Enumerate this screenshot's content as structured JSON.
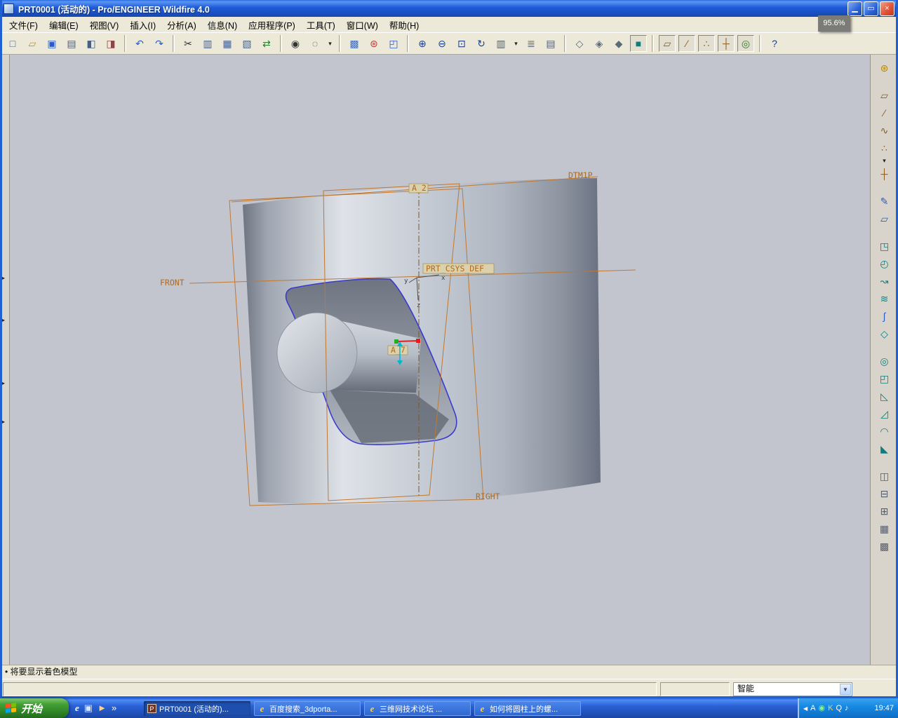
{
  "window": {
    "title": "PRT0001 (活动的) - Pro/ENGINEER Wildfire 4.0",
    "buttons": {
      "minimize": "▁",
      "restore": "▭",
      "close": "×"
    },
    "zoom_tooltip": "95.6%"
  },
  "menubar": {
    "items": [
      {
        "name": "menu-file",
        "label": "文件(F)"
      },
      {
        "name": "menu-edit",
        "label": "编辑(E)"
      },
      {
        "name": "menu-view",
        "label": "视图(V)"
      },
      {
        "name": "menu-insert",
        "label": "插入(I)"
      },
      {
        "name": "menu-analysis",
        "label": "分析(A)"
      },
      {
        "name": "menu-info",
        "label": "信息(N)"
      },
      {
        "name": "menu-applications",
        "label": "应用程序(P)"
      },
      {
        "name": "menu-tools",
        "label": "工具(T)"
      },
      {
        "name": "menu-window",
        "label": "窗口(W)"
      },
      {
        "name": "menu-help",
        "label": "帮助(H)"
      }
    ]
  },
  "toolbar": {
    "items": [
      {
        "name": "new-file-button",
        "glyph": "□",
        "color": "#46608c"
      },
      {
        "name": "open-file-button",
        "glyph": "▱",
        "color": "#c8921e"
      },
      {
        "name": "save-button",
        "glyph": "▣",
        "color": "#2b5bc8"
      },
      {
        "name": "print-button",
        "glyph": "▤",
        "color": "#555e6a"
      },
      {
        "name": "erase-display-button",
        "glyph": "◧",
        "color": "#46608c"
      },
      {
        "name": "delete-old-versions-button",
        "glyph": "◨",
        "color": "#8c4646"
      },
      {
        "sep": true
      },
      {
        "name": "undo-button",
        "glyph": "↶",
        "color": "#2b5bc8"
      },
      {
        "name": "redo-button",
        "glyph": "↷",
        "color": "#2b5bc8"
      },
      {
        "sep": true
      },
      {
        "name": "cut-button",
        "glyph": "✂",
        "color": "#333333"
      },
      {
        "name": "copy-button",
        "glyph": "▥",
        "color": "#46608c"
      },
      {
        "name": "paste-button",
        "glyph": "▦",
        "color": "#46608c"
      },
      {
        "name": "paste-special-button",
        "glyph": "▧",
        "color": "#46608c"
      },
      {
        "name": "regenerate-button",
        "glyph": "⇄",
        "color": "#2b7a2b"
      },
      {
        "sep": true
      },
      {
        "name": "find-button",
        "glyph": "◉",
        "color": "#333333"
      },
      {
        "name": "selection-filter-button",
        "glyph": "◌",
        "color": "#333333"
      },
      {
        "name": "selection-filter-dropdown",
        "glyph": "▾"
      },
      {
        "sep": true
      },
      {
        "name": "repaint-button",
        "glyph": "▩",
        "color": "#3a6ec8"
      },
      {
        "name": "spin-center-button",
        "glyph": "⊛",
        "color": "#c03a3a"
      },
      {
        "name": "orient-mode-button",
        "glyph": "◰",
        "color": "#2b5bc8"
      },
      {
        "sep": true
      },
      {
        "name": "zoom-in-button",
        "glyph": "⊕",
        "color": "#1b3f8f"
      },
      {
        "name": "zoom-out-button",
        "glyph": "⊖",
        "color": "#1b3f8f"
      },
      {
        "name": "refit-button",
        "glyph": "⊡",
        "color": "#1b3f8f"
      },
      {
        "name": "reorient-button",
        "glyph": "↻",
        "color": "#1b3f8f"
      },
      {
        "name": "saved-views-button",
        "glyph": "▥",
        "color": "#555e6a"
      },
      {
        "name": "saved-views-dropdown",
        "glyph": "▾"
      },
      {
        "name": "layers-button",
        "glyph": "≣",
        "color": "#555e6a"
      },
      {
        "name": "view-manager-button",
        "glyph": "▤",
        "color": "#555e6a"
      },
      {
        "sep": true
      },
      {
        "name": "wireframe-display-button",
        "glyph": "◇",
        "color": "#5a6b7a"
      },
      {
        "name": "hidden-line-display-button",
        "glyph": "◈",
        "color": "#5a6b7a"
      },
      {
        "name": "no-hidden-display-button",
        "glyph": "◆",
        "color": "#5a6b7a"
      },
      {
        "name": "shaded-display-button",
        "glyph": "■",
        "color": "#0e7d7d",
        "pressed": true
      },
      {
        "sep": true
      },
      {
        "name": "datum-planes-toggle",
        "glyph": "▱",
        "color": "#8a5a20",
        "pressed": true
      },
      {
        "name": "datum-axes-toggle",
        "glyph": "∕",
        "color": "#8a5a20",
        "pressed": true
      },
      {
        "name": "datum-points-toggle",
        "glyph": "∴",
        "color": "#8a5a20",
        "pressed": true
      },
      {
        "name": "datum-csys-toggle",
        "glyph": "┼",
        "color": "#8a5a20",
        "pressed": true
      },
      {
        "name": "spin-center-toggle",
        "glyph": "◎",
        "color": "#2b7a2b",
        "pressed": true
      },
      {
        "sep": true
      },
      {
        "name": "context-help-button",
        "glyph": "?",
        "color": "#1b3f8f"
      }
    ]
  },
  "right_toolbar": {
    "items": [
      {
        "name": "smart-select-button",
        "glyph": "⊛",
        "color": "#b8860b"
      },
      {
        "sep": true
      },
      {
        "name": "datum-plane-button",
        "glyph": "▱",
        "color": "#8a5a20"
      },
      {
        "name": "datum-axis-button",
        "glyph": "∕",
        "color": "#8a5a20"
      },
      {
        "name": "datum-curve-button",
        "glyph": "∿",
        "color": "#8a5a20"
      },
      {
        "name": "datum-point-button",
        "glyph": "∴",
        "color": "#8a5a20"
      },
      {
        "name": "datum-point-dropdown",
        "glyph": "▾"
      },
      {
        "name": "coordinate-system-button",
        "glyph": "┼",
        "color": "#8a5a20"
      },
      {
        "sep": true
      },
      {
        "name": "sketch-tool-button",
        "glyph": "✎",
        "color": "#2b5bc8"
      },
      {
        "name": "sketch-plane-button",
        "glyph": "▱",
        "color": "#2b5bc8"
      },
      {
        "sep": true
      },
      {
        "name": "extrude-button",
        "glyph": "◳",
        "color": "#0e7d7d"
      },
      {
        "name": "revolve-button",
        "glyph": "◴",
        "color": "#0e7d7d"
      },
      {
        "name": "sweep-button",
        "glyph": "↝",
        "color": "#0e7d7d"
      },
      {
        "name": "boundary-blend-button",
        "glyph": "≋",
        "color": "#0e7d7d"
      },
      {
        "name": "style-button",
        "glyph": "∫",
        "color": "#2b5bc8"
      },
      {
        "name": "warp-button",
        "glyph": "◇",
        "color": "#0e7d7d"
      },
      {
        "sep": true
      },
      {
        "name": "hole-button",
        "glyph": "◎",
        "color": "#0e7d7d"
      },
      {
        "name": "shell-button",
        "glyph": "◰",
        "color": "#0e7d7d"
      },
      {
        "name": "rib-button",
        "glyph": "◺",
        "color": "#0e7d7d"
      },
      {
        "name": "draft-button",
        "glyph": "◿",
        "color": "#0e7d7d"
      },
      {
        "name": "round-button",
        "glyph": "◠",
        "color": "#0e7d7d"
      },
      {
        "name": "chamfer-button",
        "glyph": "◣",
        "color": "#0e7d7d"
      },
      {
        "sep": true
      },
      {
        "name": "mirror-button",
        "glyph": "◫",
        "color": "#555e6a"
      },
      {
        "name": "trim-button",
        "glyph": "⊟",
        "color": "#555e6a"
      },
      {
        "name": "merge-button",
        "glyph": "⊞",
        "color": "#555e6a"
      },
      {
        "name": "pattern-button",
        "glyph": "▦",
        "color": "#555e6a"
      },
      {
        "name": "utilities-button",
        "glyph": "▩",
        "color": "#555e6a"
      }
    ]
  },
  "left_strip": {
    "arrow": "▸"
  },
  "viewport": {
    "labels": {
      "dtm_plane": "DTM1P",
      "axis_top": "A_2",
      "front": "FRONT",
      "csys": "PRT_CSYS_DEF",
      "right": "RIGHT",
      "axis_inner": "A_7",
      "x": "x",
      "y": "y",
      "z": "z"
    }
  },
  "status": {
    "message": "• 将要显示着色模型"
  },
  "filter": {
    "value": "智能",
    "arrow": "▼"
  },
  "taskbar": {
    "start_label": "开始",
    "icons": {
      "proe_glyph": "P",
      "ie_glyph": "e"
    },
    "tasks": [
      {
        "label": "PRT0001 (活动的)...",
        "active": true
      },
      {
        "label": "百度搜索_3dporta..."
      },
      {
        "label": "三维网技术论坛 ..."
      },
      {
        "label": "如何将圆柱上的螺..."
      }
    ]
  },
  "quick_launch": {
    "items": [
      {
        "name": "ie-quicklaunch-icon",
        "glyph": "e",
        "color": "#ffffff"
      },
      {
        "name": "show-desktop-icon",
        "glyph": "▣",
        "color": "#d7e6ff"
      },
      {
        "name": "media-player-icon",
        "glyph": "►",
        "color": "#ffd28a"
      },
      {
        "name": "quicklaunch-overflow-chevron",
        "glyph": "»",
        "color": "#ffffff"
      }
    ]
  },
  "tray": {
    "hide_chevron": "◀",
    "icons": [
      {
        "name": "input-method-icon",
        "glyph": "A",
        "color": "#ffffff"
      },
      {
        "name": "antivirus-icon",
        "glyph": "◉",
        "color": "#8af28a"
      },
      {
        "name": "kugou-icon",
        "glyph": "K",
        "color": "#ffd24a"
      },
      {
        "name": "qq-icon",
        "glyph": "Q",
        "color": "#ffffff"
      },
      {
        "name": "volume-icon",
        "glyph": "♪",
        "color": "#ffffff"
      }
    ],
    "clock": "19:47"
  },
  "colors": {
    "datum_orange": "#c07830",
    "titlebar_blue": "#1e5ad8",
    "taskbar_blue": "#2a62d8",
    "viewport_gray": "#c3c5ce",
    "ui_face": "#ece9d8",
    "sketch_blue": "#3a3ace"
  }
}
